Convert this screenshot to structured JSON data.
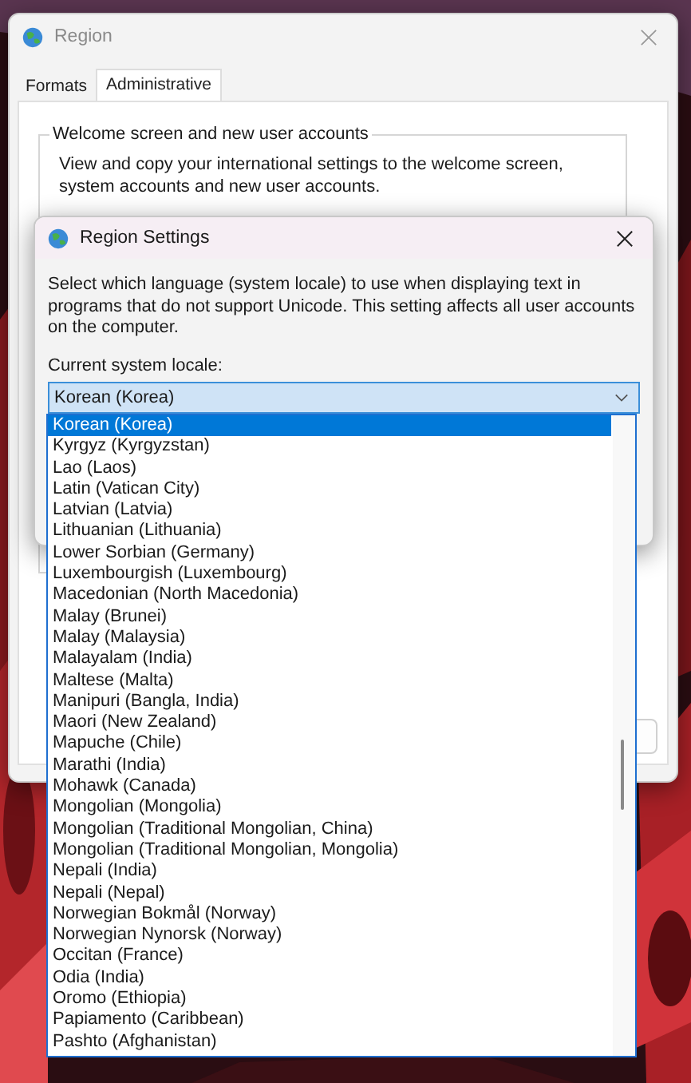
{
  "region_window": {
    "title": "Region",
    "tabs": [
      {
        "label": "Formats",
        "selected": false
      },
      {
        "label": "Administrative",
        "selected": true
      }
    ],
    "group": {
      "title": "Welcome screen and new user accounts",
      "description": "View and copy your international settings to the welcome screen, system accounts and new user accounts."
    }
  },
  "region_settings_dialog": {
    "title": "Region Settings",
    "description": "Select which language (system locale) to use when displaying text in programs that do not support Unicode. This setting affects all user accounts on the computer.",
    "locale_label": "Current system locale:",
    "locale_value": "Korean (Korea)",
    "dropdown": {
      "expanded": true,
      "items": [
        {
          "label": "Korean (Korea)",
          "selected": true
        },
        {
          "label": "Kyrgyz (Kyrgyzstan)",
          "selected": false
        },
        {
          "label": "Lao (Laos)",
          "selected": false
        },
        {
          "label": "Latin (Vatican City)",
          "selected": false
        },
        {
          "label": "Latvian (Latvia)",
          "selected": false
        },
        {
          "label": "Lithuanian (Lithuania)",
          "selected": false
        },
        {
          "label": "Lower Sorbian (Germany)",
          "selected": false
        },
        {
          "label": "Luxembourgish (Luxembourg)",
          "selected": false
        },
        {
          "label": "Macedonian (North Macedonia)",
          "selected": false
        },
        {
          "label": "Malay (Brunei)",
          "selected": false
        },
        {
          "label": "Malay (Malaysia)",
          "selected": false
        },
        {
          "label": "Malayalam (India)",
          "selected": false
        },
        {
          "label": "Maltese (Malta)",
          "selected": false
        },
        {
          "label": "Manipuri (Bangla, India)",
          "selected": false
        },
        {
          "label": "Maori (New Zealand)",
          "selected": false
        },
        {
          "label": "Mapuche (Chile)",
          "selected": false
        },
        {
          "label": "Marathi (India)",
          "selected": false
        },
        {
          "label": "Mohawk (Canada)",
          "selected": false
        },
        {
          "label": "Mongolian (Mongolia)",
          "selected": false
        },
        {
          "label": "Mongolian (Traditional Mongolian, China)",
          "selected": false
        },
        {
          "label": "Mongolian (Traditional Mongolian, Mongolia)",
          "selected": false
        },
        {
          "label": "Nepali (India)",
          "selected": false
        },
        {
          "label": "Nepali (Nepal)",
          "selected": false
        },
        {
          "label": "Norwegian Bokmål (Norway)",
          "selected": false
        },
        {
          "label": "Norwegian Nynorsk (Norway)",
          "selected": false
        },
        {
          "label": "Occitan (France)",
          "selected": false
        },
        {
          "label": "Odia (India)",
          "selected": false
        },
        {
          "label": "Oromo (Ethiopia)",
          "selected": false
        },
        {
          "label": "Papiamento (Caribbean)",
          "selected": false
        },
        {
          "label": "Pashto (Afghanistan)",
          "selected": false
        }
      ]
    }
  }
}
